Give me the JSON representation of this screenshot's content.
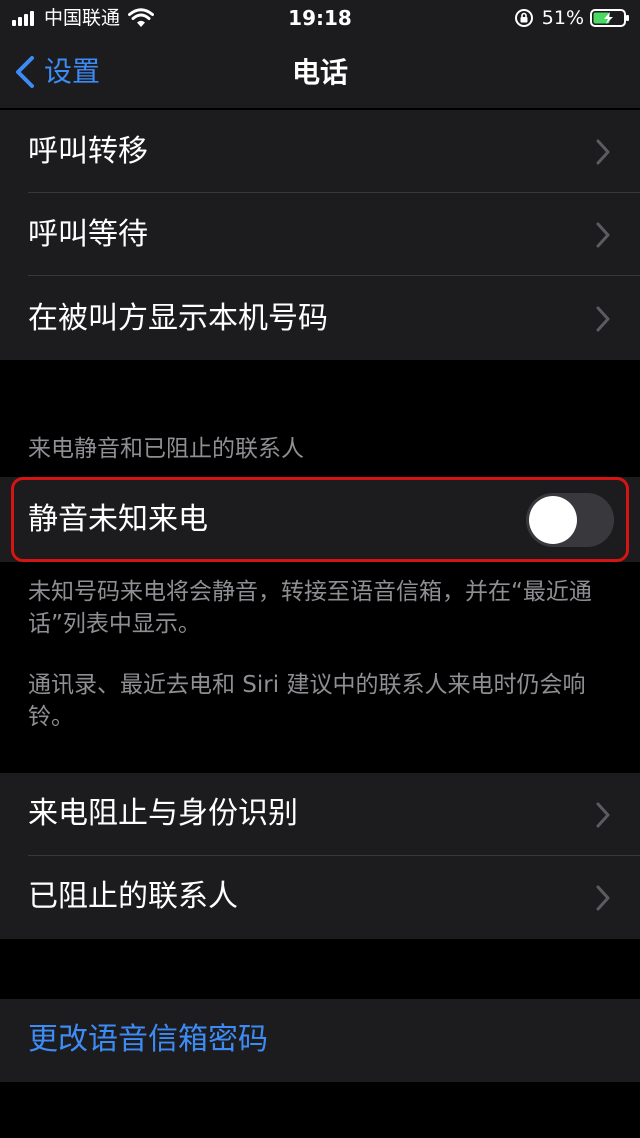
{
  "status_bar": {
    "carrier": "中国联通",
    "time": "19:18",
    "battery_percent": "51%"
  },
  "nav": {
    "back_label": "设置",
    "title": "电话"
  },
  "group1": [
    {
      "label": "呼叫转移"
    },
    {
      "label": "呼叫等待"
    },
    {
      "label": "在被叫方显示本机号码"
    }
  ],
  "silence_section": {
    "header": "来电静音和已阻止的联系人",
    "toggle_label": "静音未知来电",
    "toggle_on": false,
    "note1": "未知号码来电将会静音，转接至语音信箱，并在“最近通话”列表中显示。",
    "note2": "通讯录、最近去电和 Siri 建议中的联系人来电时仍会响铃。"
  },
  "group3": [
    {
      "label": "来电阻止与身份识别"
    },
    {
      "label": "已阻止的联系人"
    }
  ],
  "voicemail": {
    "label": "更改语音信箱密码"
  },
  "colors": {
    "accent": "#3d8cf5",
    "highlight": "#d51414",
    "cell_bg": "#1c1c1e",
    "background": "#000000"
  }
}
